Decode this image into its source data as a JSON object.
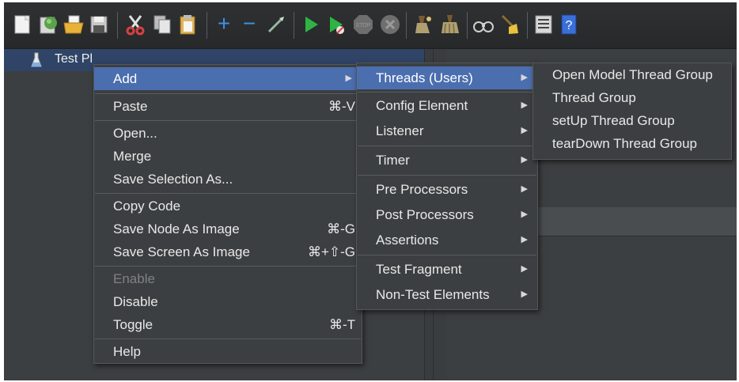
{
  "toolbar": {
    "buttons": [
      {
        "name": "new-icon",
        "color": "#f2f2f2"
      },
      {
        "name": "templates-icon",
        "color": "#5aa34a"
      },
      {
        "name": "open-icon",
        "color": "#e8b23a"
      },
      {
        "name": "save-icon",
        "color": "#c9c9c9"
      },
      {
        "name": "cut-icon",
        "color": "#d94040"
      },
      {
        "name": "copy-icon",
        "color": "#d0d0d0"
      },
      {
        "name": "paste-icon",
        "color": "#e0b35a"
      },
      {
        "name": "expand-icon",
        "color": "#3d8fe6"
      },
      {
        "name": "collapse-icon",
        "color": "#3d8fe6"
      },
      {
        "name": "toggle-icon",
        "color": "#9ab6a0"
      },
      {
        "name": "start-icon",
        "color": "#2fb344"
      },
      {
        "name": "start-no-pauses-icon",
        "color": "#2fb344"
      },
      {
        "name": "stop-icon",
        "color": "#7a7a7a"
      },
      {
        "name": "shutdown-icon",
        "color": "#7a7a7a"
      },
      {
        "name": "clear-icon",
        "color": "#b0a070"
      },
      {
        "name": "clear-all-icon",
        "color": "#b0a070"
      },
      {
        "name": "search-icon",
        "color": "#cfcfcf"
      },
      {
        "name": "reset-search-icon",
        "color": "#e8c23a"
      },
      {
        "name": "function-helper-icon",
        "color": "#d8d8d8"
      },
      {
        "name": "help-icon",
        "color": "#3a6fd8"
      }
    ],
    "expand_glyph": "+",
    "collapse_glyph": "−"
  },
  "tree": {
    "root_label": "Test Pl",
    "root_icon": "flask-icon"
  },
  "context_menu": {
    "items": {
      "add": {
        "label": "Add",
        "arrow": "▶"
      },
      "paste": {
        "label": "Paste",
        "shortcut": "⌘-V"
      },
      "open": {
        "label": "Open..."
      },
      "merge": {
        "label": "Merge"
      },
      "save_selection": {
        "label": "Save Selection As..."
      },
      "copy_code": {
        "label": "Copy Code"
      },
      "save_node_image": {
        "label": "Save Node As Image",
        "shortcut": "⌘-G"
      },
      "save_screen_image": {
        "label": "Save Screen As Image",
        "shortcut": "⌘+⇧-G"
      },
      "enable": {
        "label": "Enable"
      },
      "disable": {
        "label": "Disable"
      },
      "toggle": {
        "label": "Toggle",
        "shortcut": "⌘-T"
      },
      "help": {
        "label": "Help"
      }
    }
  },
  "add_submenu": {
    "items": [
      {
        "label": "Threads (Users)",
        "arrow": "▶"
      },
      {
        "label": "Config Element",
        "arrow": "▶"
      },
      {
        "label": "Listener",
        "arrow": "▶"
      },
      {
        "label": "Timer",
        "arrow": "▶"
      },
      {
        "label": "Pre Processors",
        "arrow": "▶"
      },
      {
        "label": "Post Processors",
        "arrow": "▶"
      },
      {
        "label": "Assertions",
        "arrow": "▶"
      },
      {
        "label": "Test Fragment",
        "arrow": "▶"
      },
      {
        "label": "Non-Test Elements",
        "arrow": "▶"
      }
    ]
  },
  "threads_submenu": {
    "items": [
      {
        "label": "Open Model Thread Group"
      },
      {
        "label": "Thread Group"
      },
      {
        "label": "setUp Thread Group"
      },
      {
        "label": "tearDown Thread Group"
      }
    ]
  },
  "colors": {
    "highlight": "#4b6eaf",
    "background": "#3c3f41",
    "selection": "#2f4466"
  }
}
